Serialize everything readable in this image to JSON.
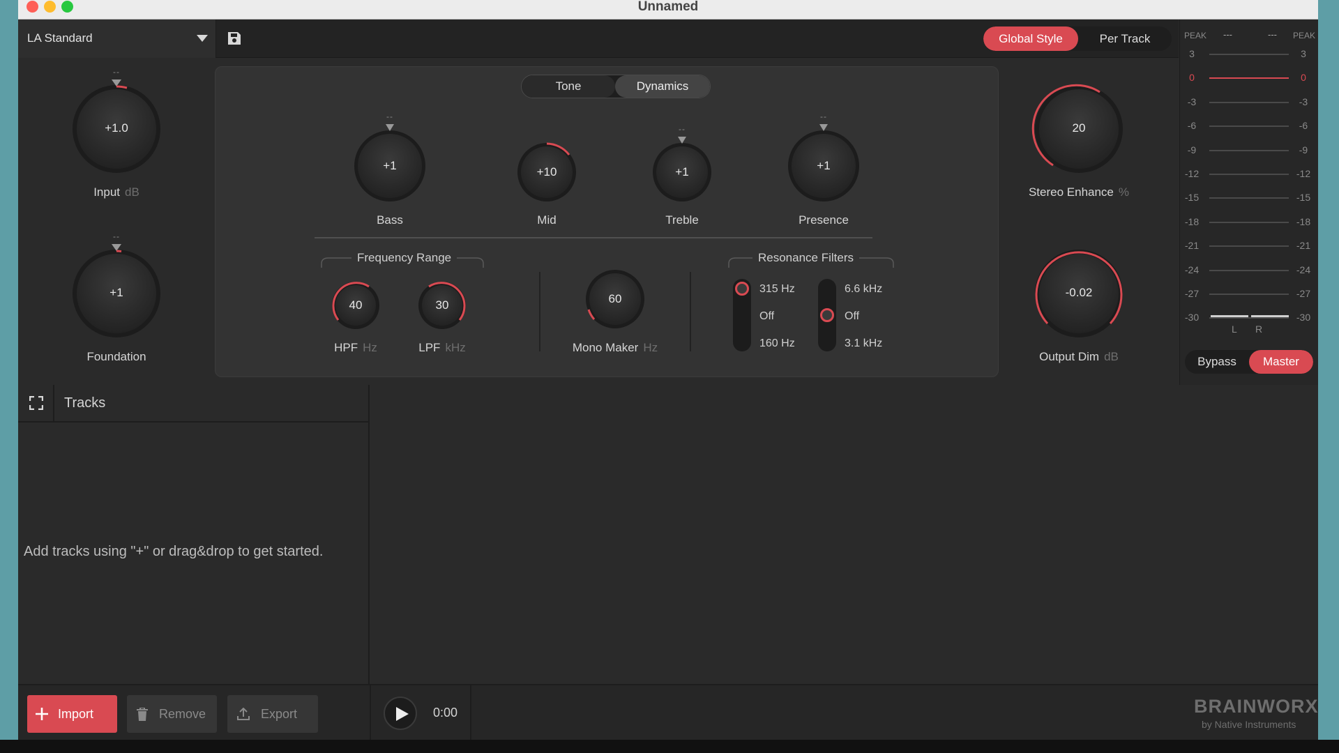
{
  "window": {
    "title": "Unnamed"
  },
  "toolbar": {
    "preset": "LA Standard",
    "mode_tabs": [
      {
        "label": "Global Style",
        "active": true
      },
      {
        "label": "Per Track",
        "active": false
      }
    ]
  },
  "left_knobs": [
    {
      "label": "Input",
      "unit": "dB",
      "value": "+1.0",
      "indicator": "--"
    },
    {
      "label": "Foundation",
      "unit": "",
      "value": "+1",
      "indicator": "--"
    }
  ],
  "panel": {
    "tabs": [
      {
        "label": "Tone",
        "active": true
      },
      {
        "label": "Dynamics",
        "active": false
      }
    ],
    "tone_knobs": [
      {
        "label": "Bass",
        "value": "+1",
        "indicator": "--"
      },
      {
        "label": "Mid",
        "value": "+10",
        "indicator": ""
      },
      {
        "label": "Treble",
        "value": "+1",
        "indicator": "--"
      },
      {
        "label": "Presence",
        "value": "+1",
        "indicator": "--"
      }
    ],
    "frequency_range": {
      "title": "Frequency Range",
      "hpf": {
        "label": "HPF",
        "unit": "Hz",
        "value": "40"
      },
      "lpf": {
        "label": "LPF",
        "unit": "kHz",
        "value": "30"
      }
    },
    "mono_maker": {
      "label": "Mono Maker",
      "unit": "Hz",
      "value": "60"
    },
    "resonance": {
      "title": "Resonance Filters",
      "low": {
        "options": [
          "315 Hz",
          "Off",
          "160 Hz"
        ],
        "selected": "315 Hz"
      },
      "high": {
        "options": [
          "6.6 kHz",
          "Off",
          "3.1 kHz"
        ],
        "selected": "Off"
      }
    }
  },
  "right_knobs": [
    {
      "label": "Stereo Enhance",
      "unit": "%",
      "value": "20"
    },
    {
      "label": "Output Dim",
      "unit": "dB",
      "value": "-0.02"
    }
  ],
  "meter": {
    "peak_label": "PEAK",
    "peak_left": "---",
    "peak_right": "---",
    "scale": [
      "3",
      "0",
      "-3",
      "-6",
      "-9",
      "-12",
      "-15",
      "-18",
      "-21",
      "-24",
      "-27",
      "-30"
    ],
    "channels": [
      "L",
      "R"
    ],
    "bypass_label": "Bypass",
    "master_label": "Master"
  },
  "tracks": {
    "title": "Tracks",
    "empty_message": "Add tracks using \"+\" or drag&drop to get started."
  },
  "bottom": {
    "import_label": "Import",
    "remove_label": "Remove",
    "export_label": "Export",
    "time": "0:00",
    "brand": "BRAINWORX",
    "brand_sub": "by Native Instruments"
  },
  "colors": {
    "accent": "#d94a52",
    "panel": "#333333",
    "background": "#2a2a2a"
  }
}
